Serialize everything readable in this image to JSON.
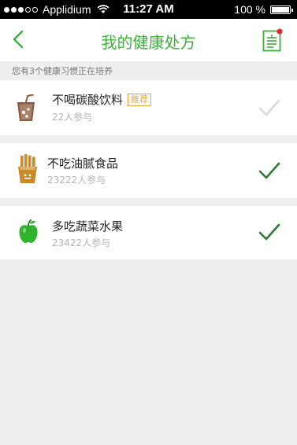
{
  "status_bar": {
    "carrier": "Applidium",
    "time": "11:27 AM",
    "battery": "100 %"
  },
  "nav": {
    "title": "我的健康处方"
  },
  "section_header": "您有3个健康习惯正在培养",
  "habits": [
    {
      "name": "不喝碳酸饮料",
      "tag": "推荐",
      "participants": "22人参与",
      "checked": false
    },
    {
      "name": "不吃油腻食品",
      "participants": "23222人参与",
      "checked": true
    },
    {
      "name": "多吃蔬菜水果",
      "participants": "23422人参与",
      "checked": true
    }
  ],
  "colors": {
    "accent": "#3fae3a",
    "check_active": "#2f7a33",
    "check_inactive": "#d8d8d8",
    "tag": "#f0a040",
    "badge": "#e8232a"
  }
}
